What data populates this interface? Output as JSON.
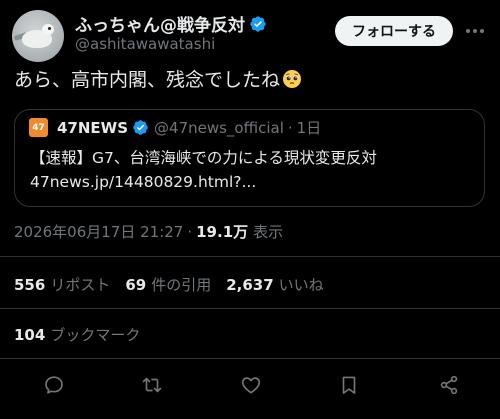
{
  "author": {
    "display_name": "ふっちゃん@戦争反対",
    "handle": "@ashitawawatashi",
    "verified": true
  },
  "follow_button": {
    "label": "フォローする"
  },
  "tweet": {
    "text": "あら、高市内閣、残念でしたね",
    "emoji": "pleading-face-emoji"
  },
  "quote": {
    "logo_text": "47",
    "name": "47NEWS",
    "handle": "@47news_official",
    "separator": "·",
    "age": "1日",
    "line1": "【速報】G7、台湾海峡での力による現状変更反対",
    "line2": "47news.jp/14480829.html?..."
  },
  "meta": {
    "timestamp": "2026年06月17日 21:27",
    "separator": "·",
    "views_value": "19.1万",
    "views_label": "表示"
  },
  "stats": {
    "reposts_value": "556",
    "reposts_label": "リポスト",
    "quotes_value": "69",
    "quotes_label": "件の引用",
    "likes_value": "2,637",
    "likes_label": "いいね"
  },
  "bookmarks": {
    "value": "104",
    "label": "ブックマーク"
  },
  "actions": [
    "reply-icon",
    "repost-icon",
    "like-icon",
    "bookmark-icon",
    "share-icon"
  ],
  "colors": {
    "background": "#000000",
    "text_primary": "#e7e9ea",
    "text_secondary": "#71767b",
    "verified_blue": "#1d9bf0",
    "divider": "#2f3336",
    "follow_button_bg": "#eff3f4",
    "quote_logo_orange": "#f28b2c"
  }
}
